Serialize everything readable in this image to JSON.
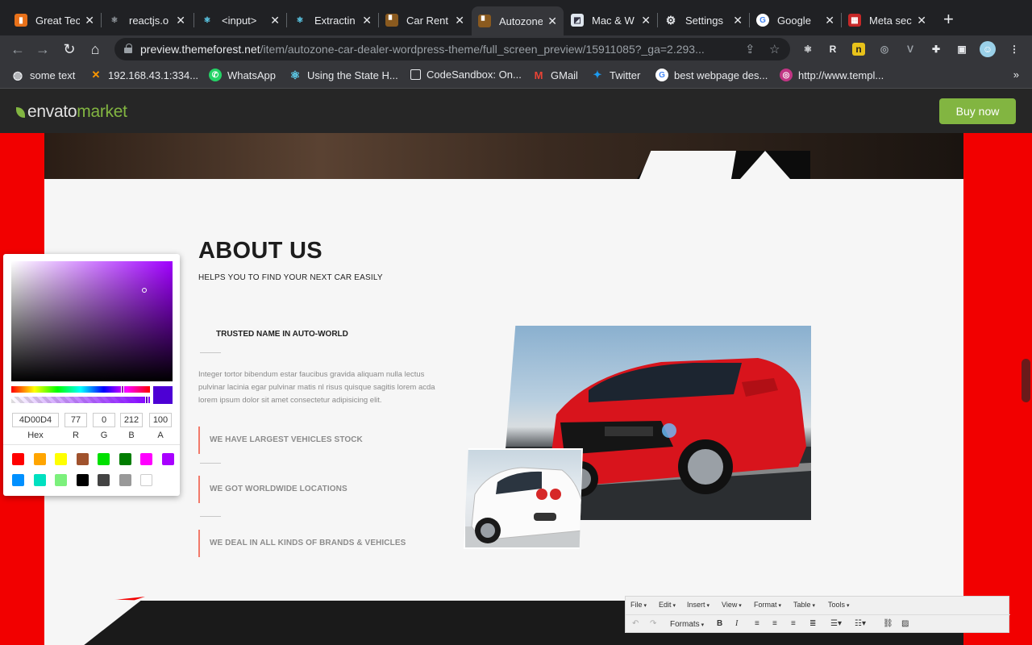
{
  "browser": {
    "tabs": [
      {
        "title": "Great Tec",
        "fav_color": "#e8711a",
        "fav_glyph": "▮"
      },
      {
        "title": "reactjs.o",
        "fav_color": "#555",
        "fav_glyph": "⚛"
      },
      {
        "title": "<input>",
        "fav_color": "#1f3a56",
        "fav_glyph": "⚛"
      },
      {
        "title": "Extractin",
        "fav_color": "#1f3a56",
        "fav_glyph": "⚛"
      },
      {
        "title": "Car Rent",
        "fav_color": "#8a5a1f",
        "fav_glyph": "▘"
      },
      {
        "title": "Autozone",
        "fav_color": "#8a5a1f",
        "fav_glyph": "▘"
      },
      {
        "title": "Mac & W",
        "fav_color": "#dfe6ee",
        "fav_glyph": "◩"
      },
      {
        "title": "Settings",
        "fav_color": "#202124",
        "fav_glyph": "⚙"
      },
      {
        "title": "Google",
        "fav_color": "#ffffff",
        "fav_glyph": "G"
      },
      {
        "title": "Meta sec",
        "fav_color": "#c62828",
        "fav_glyph": "▦"
      }
    ],
    "new_tab": "+",
    "url_host": "preview.themeforest.net",
    "url_path": "/item/autozone-car-dealer-wordpress-theme/full_screen_preview/15911085?_ga=2.293...",
    "bookmarks": [
      {
        "label": "some text",
        "color": "#e8eaed",
        "glyph": "◍"
      },
      {
        "label": "192.168.43.1:334...",
        "color": "#ff9800",
        "glyph": "✕"
      },
      {
        "label": "WhatsApp",
        "color": "#25d366",
        "glyph": "✆"
      },
      {
        "label": "Using the State H...",
        "color": "#61dafb",
        "glyph": "⚛"
      },
      {
        "label": "CodeSandbox: On...",
        "color": "#35363a",
        "glyph": "□"
      },
      {
        "label": "GMail",
        "color": "#ea4335",
        "glyph": "M"
      },
      {
        "label": "Twitter",
        "color": "#1d9bf0",
        "glyph": "✦"
      },
      {
        "label": "best webpage des...",
        "color": "#ffffff",
        "glyph": "G"
      },
      {
        "label": "http://www.templ...",
        "color": "#c13584",
        "glyph": "◎"
      }
    ],
    "bookmarks_more": "»"
  },
  "envato": {
    "logo_envato": "envato",
    "logo_market": "market",
    "buy_label": "Buy now"
  },
  "page": {
    "title": "ABOUT US",
    "subtitle": "HELPS YOU TO FIND YOUR NEXT CAR EASILY",
    "trusted": "TRUSTED NAME IN AUTO-WORLD",
    "description": "Integer tortor bibendum estar faucibus gravida aliquam nulla lectus pulvinar lacinia egar pulvinar matis nl risus quisque sagitis lorem acda lorem ipsum dolor sit amet consectetur adipisicing elit.",
    "features": [
      "WE HAVE LARGEST VEHICLES STOCK",
      "WE GOT WORLDWIDE LOCATIONS",
      "WE DEAL IN ALL KINDS OF BRANDS & VEHICLES"
    ]
  },
  "picker": {
    "hex": "4D00D4",
    "r": "77",
    "g": "0",
    "b": "212",
    "a": "100",
    "labels": {
      "hex": "Hex",
      "r": "R",
      "g": "G",
      "b": "B",
      "a": "A"
    },
    "current_color": "#4D00D4",
    "swatches": [
      "#ff0000",
      "#ffa500",
      "#ffff00",
      "#a0522d",
      "#00e000",
      "#007d00",
      "#ff00ff",
      "#a800ff",
      "#0090ff",
      "#00e0c0",
      "#7cf07c",
      "#000000",
      "#444444",
      "#999999",
      "#ffffff"
    ]
  },
  "editor": {
    "menus": [
      "File",
      "Edit",
      "Insert",
      "View",
      "Format",
      "Table",
      "Tools"
    ],
    "formats_label": "Formats"
  }
}
